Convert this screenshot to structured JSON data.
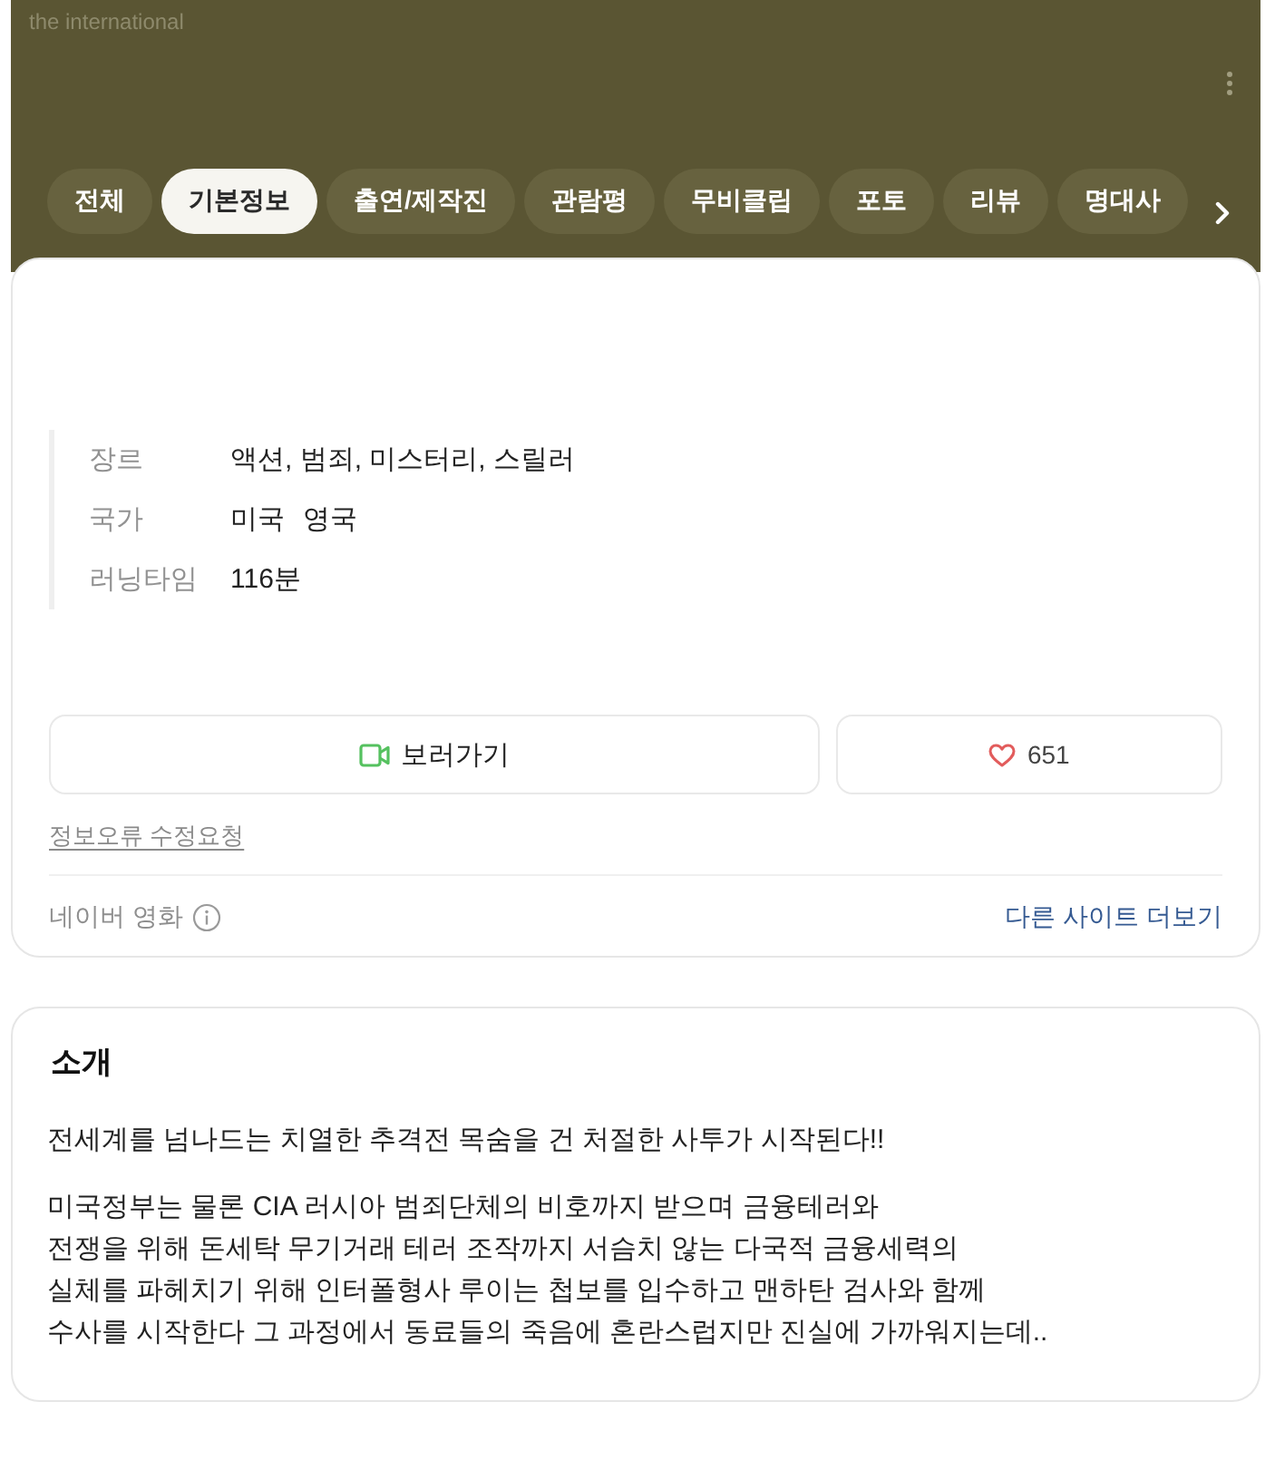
{
  "header": {
    "title": "the international"
  },
  "tabs": [
    {
      "label": "전체",
      "selected": false
    },
    {
      "label": "기본정보",
      "selected": true
    },
    {
      "label": "출연/제작진",
      "selected": false
    },
    {
      "label": "관람평",
      "selected": false
    },
    {
      "label": "무비클립",
      "selected": false
    },
    {
      "label": "포토",
      "selected": false
    },
    {
      "label": "리뷰",
      "selected": false
    },
    {
      "label": "명대사",
      "selected": false
    }
  ],
  "info": [
    {
      "label": "장르",
      "values": [
        "액션, 범죄, 미스터리, 스릴러"
      ]
    },
    {
      "label": "국가",
      "values": [
        "미국",
        "영국"
      ]
    },
    {
      "label": "러닝타임",
      "values": [
        "116분"
      ]
    }
  ],
  "actions": {
    "watch_label": "보러가기",
    "like_count": "651"
  },
  "report_link": "정보오류 수정요청",
  "source": {
    "label": "네이버 영화",
    "more_link": "다른 사이트 더보기"
  },
  "intro": {
    "title": "소개",
    "paragraphs": [
      {
        "lines": [
          "전세계를 넘나드는 치열한 추격전 목숨을 건 처절한 사투가 시작된다!!"
        ]
      },
      {
        "lines": [
          "미국정부는 물론 CIA 러시아 범죄단체의 비호까지 받으며 금융테러와",
          "전쟁을 위해 돈세탁 무기거래 테러 조작까지 서슴치 않는 다국적 금융세력의",
          "실체를 파헤치기 위해 인터폴형사 루이는 첩보를 입수하고 맨하탄 검사와 함께",
          "수사를 시작한다 그 과정에서 동료들의 죽음에 혼란스럽지만 진실에 가까워지는데.."
        ]
      }
    ]
  }
}
